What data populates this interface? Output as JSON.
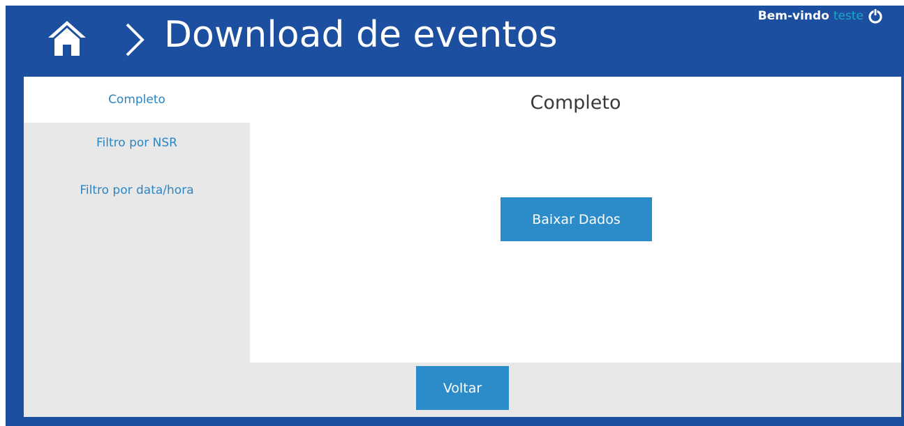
{
  "header": {
    "title": "Download de eventos",
    "welcome_label": "Bem-vindo",
    "username": "teste",
    "home_icon": "home-icon",
    "chevron_icon": "chevron-right-icon",
    "power_icon": "power-icon"
  },
  "sidebar": {
    "items": [
      {
        "label": "Completo",
        "active": true
      },
      {
        "label": "Filtro por NSR",
        "active": false
      },
      {
        "label": "Filtro por data/hora",
        "active": false
      }
    ]
  },
  "main": {
    "section_title": "Completo",
    "download_button": "Baixar Dados"
  },
  "footer": {
    "back_button": "Voltar"
  },
  "colors": {
    "header_bg": "#1c4f9f",
    "accent": "#2c8cc9",
    "link": "#2a86c4",
    "username": "#1ea7c6",
    "panel_gray": "#e8e8e8"
  }
}
